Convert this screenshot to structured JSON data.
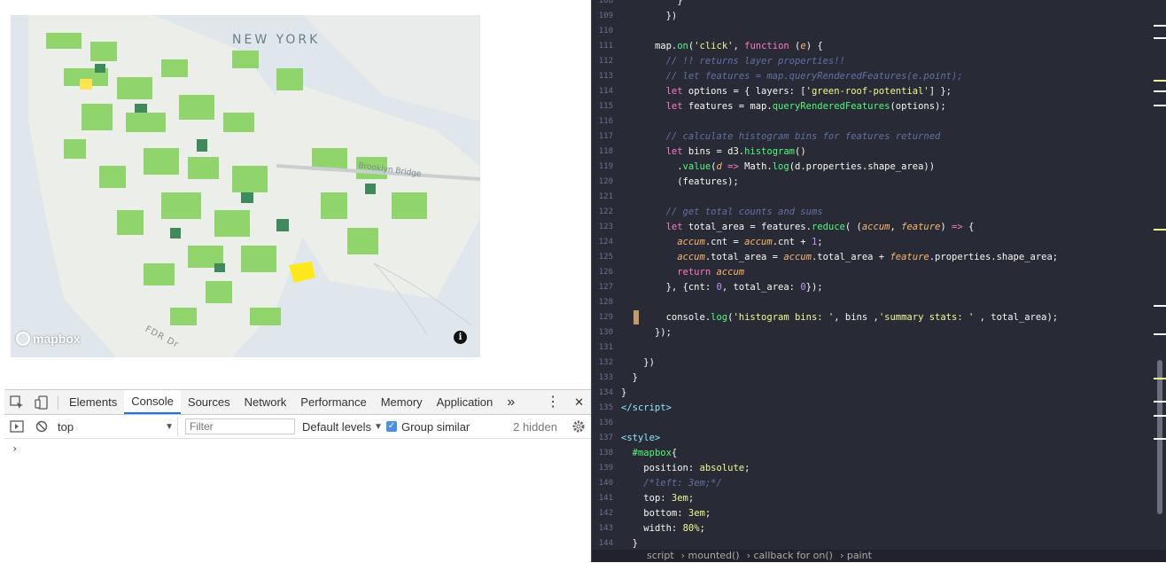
{
  "map": {
    "city_label": "NEW YORK",
    "bridge_label": "Brooklyn Bridge",
    "road_label": "FDR Dr",
    "logo_text": "mapbox",
    "info_glyph": "i"
  },
  "devtools": {
    "tabs": [
      "Elements",
      "Console",
      "Sources",
      "Network",
      "Performance",
      "Memory",
      "Application"
    ],
    "active_tab": "Console",
    "more_glyph": "»",
    "menu_glyph": "⋮",
    "close_glyph": "✕",
    "context": "top",
    "filter_placeholder": "Filter",
    "levels": "Default levels",
    "group_similar": "Group similar",
    "group_checked": true,
    "hidden_count": "2 hidden",
    "prompt": "›"
  },
  "editor": {
    "lines": [
      {
        "n": "108",
        "html": "          <span class=\"pl\">}</span>"
      },
      {
        "n": "109",
        "html": "        <span class=\"pl\">})</span>"
      },
      {
        "n": "110",
        "html": ""
      },
      {
        "n": "111",
        "html": "      <span class=\"pl\">map.</span><span class=\"fn\">on</span><span class=\"pl\">(</span><span class=\"str\">'click'</span><span class=\"pl\">, </span><span class=\"kw\">function</span><span class=\"pl\"> (</span><span class=\"var\">e</span><span class=\"pl\">) {</span>"
      },
      {
        "n": "112",
        "html": "        <span class=\"cm\">// !! returns layer properties!!</span>"
      },
      {
        "n": "113",
        "html": "        <span class=\"cm\">// let features = map.queryRenderedFeatures(e.point);</span>"
      },
      {
        "n": "114",
        "html": "        <span class=\"kw\">let</span><span class=\"pl\"> options = { layers: [</span><span class=\"str\">'green-roof-potential'</span><span class=\"pl\">] };</span>"
      },
      {
        "n": "115",
        "html": "        <span class=\"kw\">let</span><span class=\"pl\"> features = map.</span><span class=\"fn\">queryRenderedFeatures</span><span class=\"pl\">(options);</span>"
      },
      {
        "n": "116",
        "html": ""
      },
      {
        "n": "117",
        "html": "        <span class=\"cm\">// calculate histogram bins for features returned</span>"
      },
      {
        "n": "118",
        "html": "        <span class=\"kw\">let</span><span class=\"pl\"> bins = d3.</span><span class=\"fn\">histogram</span><span class=\"pl\">()</span>"
      },
      {
        "n": "119",
        "html": "          <span class=\"pl\">.</span><span class=\"fn\">value</span><span class=\"pl\">(</span><span class=\"var\">d</span><span class=\"kw\"> =&gt; </span><span class=\"pl\">Math.</span><span class=\"fn\">log</span><span class=\"pl\">(d.properties.shape_area))</span>"
      },
      {
        "n": "120",
        "html": "          <span class=\"pl\">(features);</span>"
      },
      {
        "n": "121",
        "html": ""
      },
      {
        "n": "122",
        "html": "        <span class=\"cm\">// get total counts and sums</span>"
      },
      {
        "n": "123",
        "html": "        <span class=\"kw\">let</span><span class=\"pl\"> total_area = features.</span><span class=\"fn\">reduce</span><span class=\"pl\">( (</span><span class=\"var\">accum</span><span class=\"pl\">, </span><span class=\"var\">feature</span><span class=\"pl\">) </span><span class=\"kw\">=&gt;</span><span class=\"pl\"> {</span>"
      },
      {
        "n": "124",
        "html": "          <span class=\"var\">accum</span><span class=\"pl\">.cnt = </span><span class=\"var\">accum</span><span class=\"pl\">.cnt + </span><span class=\"num\">1</span><span class=\"pl\">;</span>"
      },
      {
        "n": "125",
        "html": "          <span class=\"var\">accum</span><span class=\"pl\">.total_area = </span><span class=\"var\">accum</span><span class=\"pl\">.total_area + </span><span class=\"var\">feature</span><span class=\"pl\">.properties.shape_area;</span>"
      },
      {
        "n": "126",
        "html": "          <span class=\"kw\">return</span><span class=\"pl\"> </span><span class=\"var\">accum</span>"
      },
      {
        "n": "127",
        "html": "        <span class=\"pl\">}, {cnt: </span><span class=\"num\">0</span><span class=\"pl\">, total_area: </span><span class=\"num\">0</span><span class=\"pl\">});</span>"
      },
      {
        "n": "128",
        "html": ""
      },
      {
        "n": "129",
        "html": "        <span class=\"pl\">console.</span><span class=\"fn\">log</span><span class=\"pl\">(</span><span class=\"str\">'histogram bins: '</span><span class=\"pl\">, bins ,</span><span class=\"str\">'summary stats: '</span><span class=\"pl\"> , total_area);</span>"
      },
      {
        "n": "130",
        "html": "      <span class=\"pl\">});</span>"
      },
      {
        "n": "131",
        "html": ""
      },
      {
        "n": "132",
        "html": "    <span class=\"pl\">})</span>"
      },
      {
        "n": "133",
        "html": "  <span class=\"pl\">}</span>"
      },
      {
        "n": "134",
        "html": "<span class=\"pl\">}</span>"
      },
      {
        "n": "135",
        "html": "<span class=\"tag\">&lt;/script&gt;</span>"
      },
      {
        "n": "136",
        "html": ""
      },
      {
        "n": "137",
        "html": "<span class=\"tag\">&lt;style&gt;</span>"
      },
      {
        "n": "138",
        "html": "  <span class=\"fn\">#mapbox</span><span class=\"pl\">{</span>"
      },
      {
        "n": "139",
        "html": "    <span class=\"pl\">position: </span><span class=\"str\">absolute</span><span class=\"pl\">;</span>"
      },
      {
        "n": "140",
        "html": "    <span class=\"cm\">/*left: 3em;*/</span>"
      },
      {
        "n": "141",
        "html": "    <span class=\"pl\">top: </span><span class=\"str\">3em</span><span class=\"pl\">;</span>"
      },
      {
        "n": "142",
        "html": "    <span class=\"pl\">bottom: </span><span class=\"str\">3em</span><span class=\"pl\">;</span>"
      },
      {
        "n": "143",
        "html": "    <span class=\"pl\">width: </span><span class=\"str\">80%</span><span class=\"pl\">;</span>"
      },
      {
        "n": "144",
        "html": "  <span class=\"pl\">}</span>"
      }
    ],
    "breadcrumbs": [
      "script",
      "mounted()",
      "callback for on()",
      "paint"
    ]
  }
}
